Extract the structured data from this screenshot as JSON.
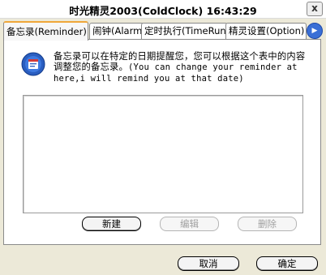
{
  "window": {
    "title": "时光精灵2003(ColdClock) 16:43:29",
    "close_label": "x"
  },
  "tabs": [
    {
      "label": "备忘录(Reminder)"
    },
    {
      "label": "闹钟(Alarm)"
    },
    {
      "label": "定时执行(TimeRun"
    },
    {
      "label": "精灵设置(Option)"
    }
  ],
  "tab_scroll_label": "▶",
  "reminder": {
    "description_cn": "备忘录可以在特定的日期提醒您，您可以根据这个表中的内容调整您的备忘录。",
    "description_en": "(You can change your reminder at here,i will remind you at that date)",
    "items": [],
    "new_label": "新建",
    "edit_label": "编辑",
    "delete_label": "删除"
  },
  "footer": {
    "cancel_label": "取消",
    "ok_label": "确定"
  },
  "colors": {
    "active_tab_accent": "#f0a73a",
    "icon_blue": "#2a5ec0"
  }
}
